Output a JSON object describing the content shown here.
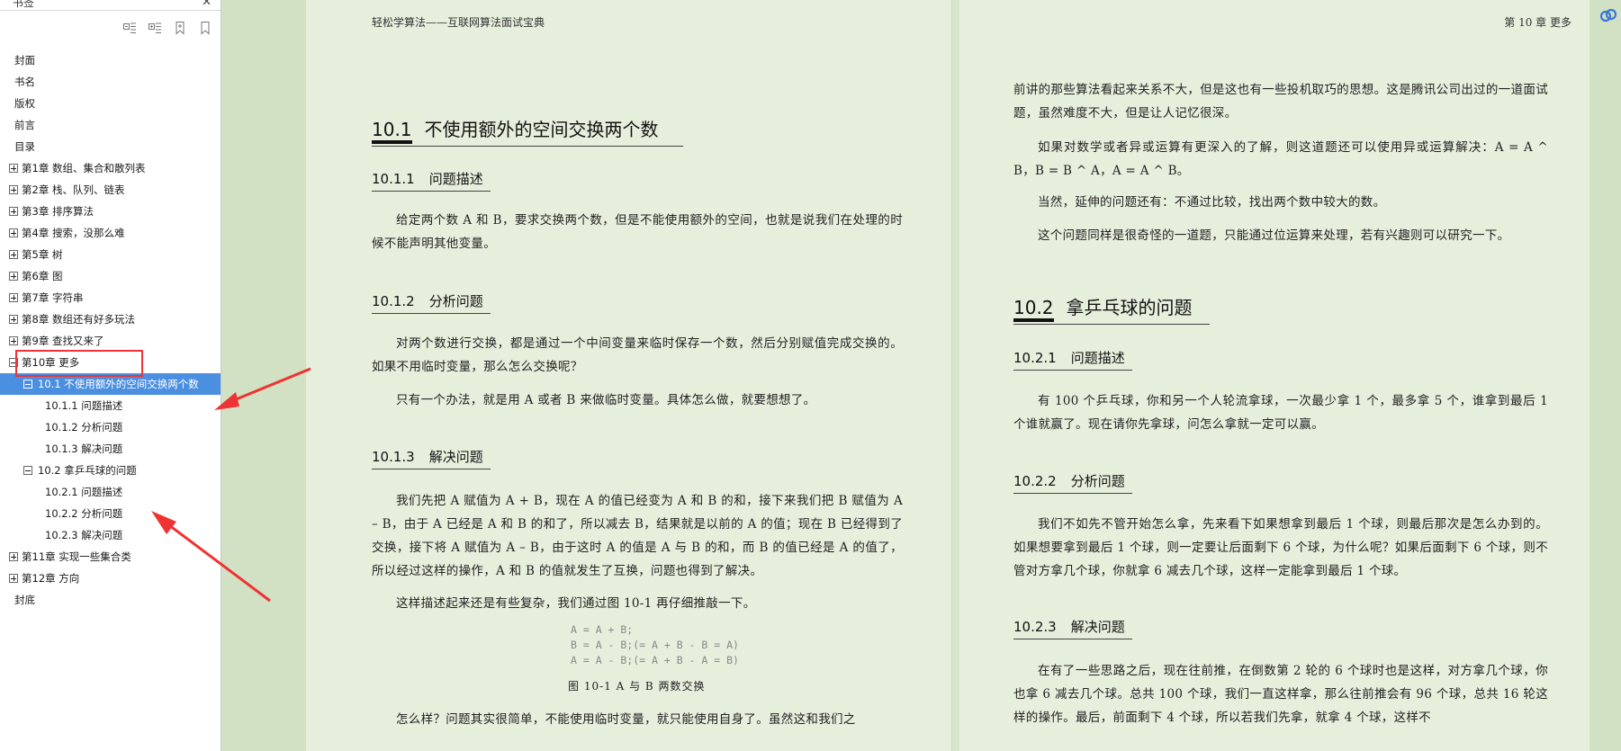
{
  "sidebar": {
    "title": "书签",
    "close": "✕",
    "toc": [
      {
        "label": "封面",
        "level": 0
      },
      {
        "label": "书名",
        "level": 0
      },
      {
        "label": "版权",
        "level": 0
      },
      {
        "label": "前言",
        "level": 0
      },
      {
        "label": "目录",
        "level": 0
      },
      {
        "label": "第1章  数组、集合和散列表",
        "level": 1,
        "exp": "plus"
      },
      {
        "label": "第2章  栈、队列、链表",
        "level": 1,
        "exp": "plus"
      },
      {
        "label": "第3章  排序算法",
        "level": 1,
        "exp": "plus"
      },
      {
        "label": "第4章  搜索，没那么难",
        "level": 1,
        "exp": "plus"
      },
      {
        "label": "第5章  树",
        "level": 1,
        "exp": "plus"
      },
      {
        "label": "第6章  图",
        "level": 1,
        "exp": "plus"
      },
      {
        "label": "第7章  字符串",
        "level": 1,
        "exp": "plus"
      },
      {
        "label": "第8章  数组还有好多玩法",
        "level": 1,
        "exp": "plus"
      },
      {
        "label": "第9章  查找又来了",
        "level": 1,
        "exp": "plus"
      },
      {
        "label": "第10章  更多",
        "level": 1,
        "exp": "minus"
      },
      {
        "label": "10.1  不使用额外的空间交换两个数",
        "level": 2,
        "exp": "minus",
        "selected": true
      },
      {
        "label": "10.1.1  问题描述",
        "level": 3
      },
      {
        "label": "10.1.2  分析问题",
        "level": 3
      },
      {
        "label": "10.1.3  解决问题",
        "level": 3
      },
      {
        "label": "10.2  拿乒乓球的问题",
        "level": 2,
        "exp": "minus"
      },
      {
        "label": "10.2.1  问题描述",
        "level": 3
      },
      {
        "label": "10.2.2  分析问题",
        "level": 3
      },
      {
        "label": "10.2.3  解决问题",
        "level": 3
      },
      {
        "label": "第11章  实现一些集合类",
        "level": 1,
        "exp": "plus"
      },
      {
        "label": "第12章  方向",
        "level": 1,
        "exp": "plus"
      },
      {
        "label": "封底",
        "level": 0
      }
    ]
  },
  "left_page": {
    "running_head": "轻松学算法——互联网算法面试宝典",
    "sec_num": "10.1",
    "sec_title": "不使用额外的空间交换两个数",
    "sub1_num": "10.1.1",
    "sub1_title": "问题描述",
    "p1": "给定两个数 A 和 B，要求交换两个数，但是不能使用额外的空间，也就是说我们在处理的时候不能声明其他变量。",
    "sub2_num": "10.1.2",
    "sub2_title": "分析问题",
    "p2": "对两个数进行交换，都是通过一个中间变量来临时保存一个数，然后分别赋值完成交换的。如果不用临时变量，那么怎么交换呢？",
    "p3": "只有一个办法，就是用 A 或者 B 来做临时变量。具体怎么做，就要想想了。",
    "sub3_num": "10.1.3",
    "sub3_title": "解决问题",
    "p4": "我们先把 A 赋值为 A + B，现在 A 的值已经变为 A 和 B 的和，接下来我们把 B 赋值为 A – B，由于 A 已经是 A 和 B 的和了，所以减去 B，结果就是以前的 A 的值；现在 B 已经得到了交换，接下将 A 赋值为 A – B，由于这时 A 的值是 A 与 B 的和，而 B 的值已经是 A 的值了，所以经过这样的操作，A 和 B 的值就发生了互换，问题也得到了解决。",
    "p5": "这样描述起来还是有些复杂，我们通过图 10-1 再仔细推敲一下。",
    "code1": "A = A + B;",
    "code2": "B = A - B;(= A + B - B = A)",
    "code3": "A = A - B;(= A + B - A = B)",
    "fig_caption": "图 10-1   A 与 B 两数交换",
    "p6": "怎么样？问题其实很简单，不能使用临时变量，就只能使用自身了。虽然这和我们之"
  },
  "right_page": {
    "running_head": "第 10 章   更多",
    "p1": "前讲的那些算法看起来关系不大，但是这也有一些投机取巧的思想。这是腾讯公司出过的一道面试题，虽然难度不大，但是让人记忆很深。",
    "p2": "如果对数学或者异或运算有更深入的了解，则这道题还可以使用异或运算解决：A = A ^ B，B = B ^ A，A = A ^ B。",
    "p3": "当然，延伸的问题还有：不通过比较，找出两个数中较大的数。",
    "p4": "这个问题同样是很奇怪的一道题，只能通过位运算来处理，若有兴趣则可以研究一下。",
    "sec_num": "10.2",
    "sec_title": "拿乒乓球的问题",
    "sub1_num": "10.2.1",
    "sub1_title": "问题描述",
    "p5": "有 100 个乒乓球，你和另一个人轮流拿球，一次最少拿 1 个，最多拿 5 个，谁拿到最后 1 个谁就赢了。现在请你先拿球，问怎么拿就一定可以赢。",
    "sub2_num": "10.2.2",
    "sub2_title": "分析问题",
    "p6": "我们不如先不管开始怎么拿，先来看下如果想拿到最后 1 个球，则最后那次是怎么办到的。如果想要拿到最后 1 个球，则一定要让后面剩下 6 个球，为什么呢？如果后面剩下 6 个球，则不管对方拿几个球，你就拿 6 减去几个球，这样一定能拿到最后 1 个球。",
    "sub3_num": "10.2.3",
    "sub3_title": "解决问题",
    "p7": "在有了一些思路之后，现在往前推，在倒数第 2 轮的 6 个球时也是这样，对方拿几个球，你也拿 6 减去几个球。总共 100 个球，我们一直这样拿，那么往前推会有 96 个球，总共 16 轮这样的操作。最后，前面剩下 4 个球，所以若我们先拿，就拿 4 个球，这样不"
  },
  "colors": {
    "selection": "#4b8fe0",
    "annotation_red": "#ee3333",
    "page_bg": "#e6efdc"
  }
}
